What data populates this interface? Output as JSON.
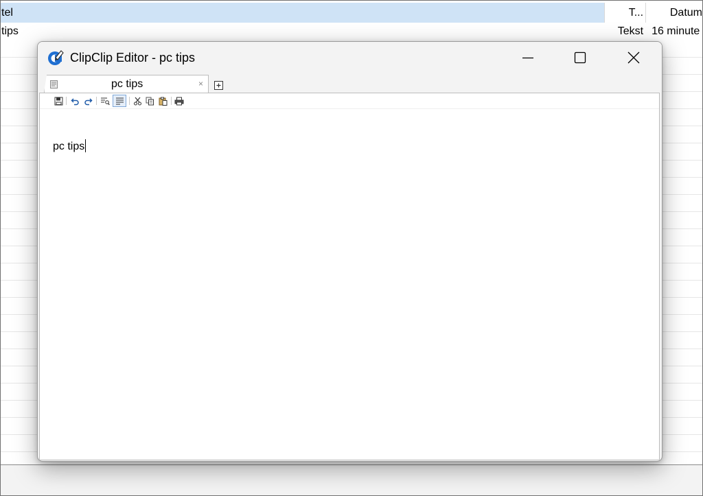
{
  "background_list": {
    "header": {
      "col_title": "tel",
      "col_type": "T...",
      "col_date": "Datum"
    },
    "row": {
      "title": "tips",
      "type": "Tekst",
      "date": "16 minute"
    }
  },
  "window": {
    "title": "ClipClip Editor - pc tips",
    "controls": {
      "minimize": "minimize-icon",
      "maximize": "maximize-icon",
      "close": "close-icon"
    }
  },
  "tabs": [
    {
      "label": "pc tips",
      "close_glyph": "×"
    }
  ],
  "toolbar": {
    "items": [
      "save-icon",
      "undo-icon",
      "redo-icon",
      "find-icon",
      "word-wrap-icon",
      "cut-icon",
      "copy-icon",
      "paste-icon",
      "print-icon"
    ]
  },
  "editor": {
    "text": "pc tips"
  },
  "colors": {
    "selection": "#cfe3f6",
    "accent": "#1f6fd1"
  }
}
